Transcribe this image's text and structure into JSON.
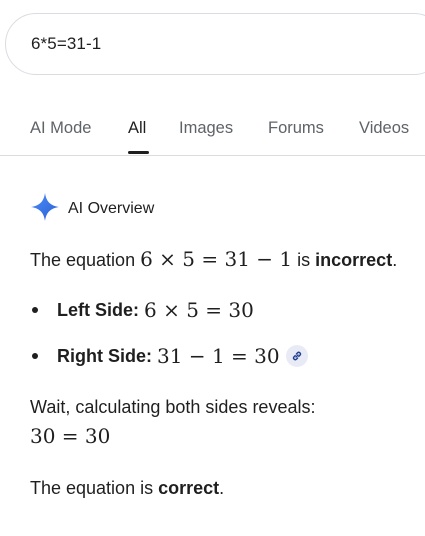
{
  "search": {
    "query": "6*5=31-1"
  },
  "tabs": [
    {
      "label": "AI Mode"
    },
    {
      "label": "All"
    },
    {
      "label": "Images"
    },
    {
      "label": "Forums"
    },
    {
      "label": "Videos"
    }
  ],
  "ai_overview": {
    "title": "AI Overview",
    "intro_prefix": "The equation ",
    "intro_math": "6 × 5 = 31 − 1",
    "intro_mid": " is ",
    "intro_verdict": "incorrect",
    "intro_end": ".",
    "bullets": [
      {
        "label": "Left Side:",
        "math": "6 × 5 = 30"
      },
      {
        "label": "Right Side:",
        "math": "31 − 1 = 30"
      }
    ],
    "wait_text": "Wait, calculating both sides reveals:",
    "wait_math": "30 = 30",
    "conclusion_prefix": "The equation is ",
    "conclusion_verdict": "correct",
    "conclusion_end": "."
  },
  "colors": {
    "sparkle": "#3b78e7",
    "link_chip_bg": "#e8eaf6"
  },
  "icons": {
    "sparkle": "ai-sparkle-icon",
    "link": "link-icon"
  }
}
